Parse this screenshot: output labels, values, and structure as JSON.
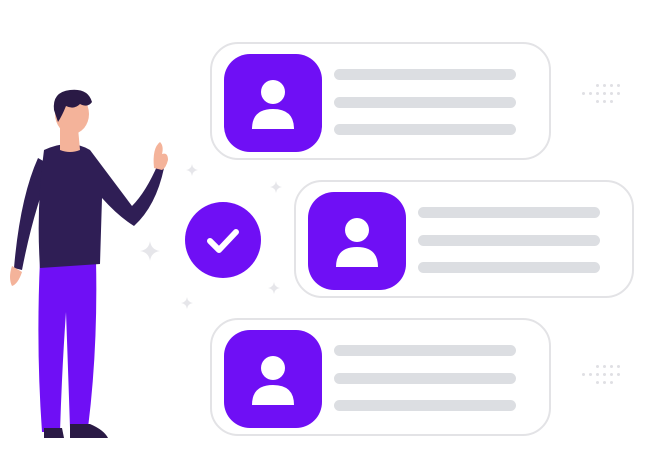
{
  "illustration": {
    "subject": "person-with-profile-list",
    "cards": [
      {
        "id": "card-1",
        "icon": "user-icon",
        "lines": 3
      },
      {
        "id": "card-2",
        "icon": "user-icon",
        "lines": 3
      },
      {
        "id": "card-3",
        "icon": "user-icon",
        "lines": 3
      }
    ],
    "badge_icon": "check-icon"
  },
  "colors": {
    "accent": "#6f0ff5",
    "card_border": "#e3e3e6",
    "placeholder_line": "#dcdee2",
    "person_shirt": "#2f1e55",
    "person_pants": "#6f0ff5",
    "person_skin": "#f4b39a",
    "person_hair": "#2a1a45",
    "sparkle": "#e6e6ea",
    "dots": "#e0e0e4"
  }
}
